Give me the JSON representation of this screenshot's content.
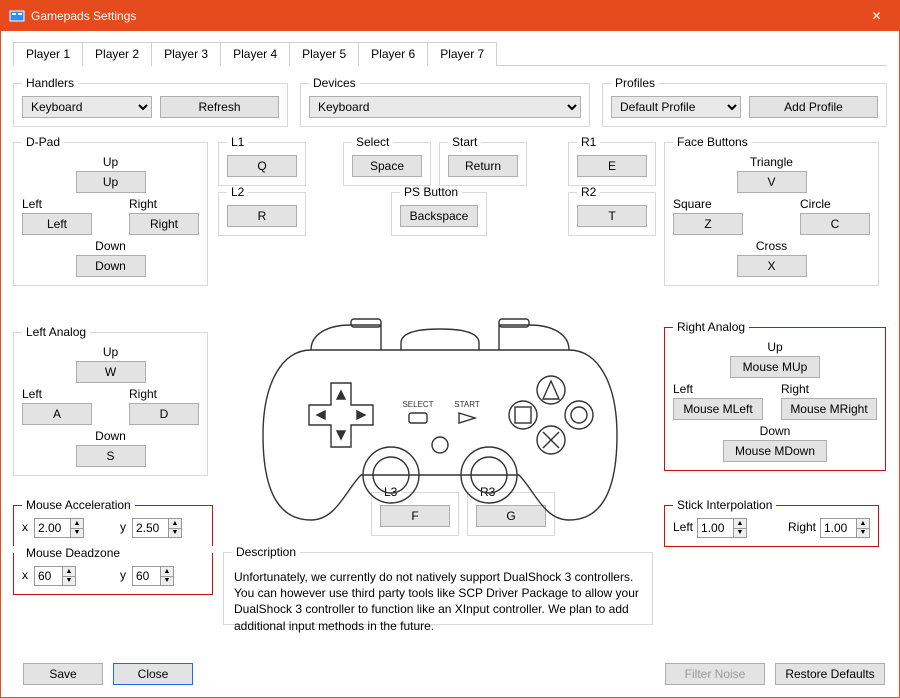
{
  "window": {
    "title": "Gamepads Settings",
    "close_glyph": "✕"
  },
  "tabs": [
    "Player 1",
    "Player 2",
    "Player 3",
    "Player 4",
    "Player 5",
    "Player 6",
    "Player 7"
  ],
  "active_tab": 0,
  "handlers": {
    "legend": "Handlers",
    "select_value": "Keyboard",
    "refresh": "Refresh"
  },
  "devices": {
    "legend": "Devices",
    "select_value": "Keyboard"
  },
  "profiles": {
    "legend": "Profiles",
    "select_value": "Default Profile",
    "add": "Add Profile"
  },
  "dpad": {
    "legend": "D-Pad",
    "up": {
      "label": "Up",
      "value": "Up"
    },
    "left": {
      "label": "Left",
      "value": "Left"
    },
    "right": {
      "label": "Right",
      "value": "Right"
    },
    "down": {
      "label": "Down",
      "value": "Down"
    }
  },
  "l1": {
    "legend": "L1",
    "value": "Q"
  },
  "l2": {
    "legend": "L2",
    "value": "R"
  },
  "select_btn": {
    "legend": "Select",
    "value": "Space"
  },
  "start_btn": {
    "legend": "Start",
    "value": "Return"
  },
  "ps": {
    "legend": "PS Button",
    "value": "Backspace"
  },
  "r1": {
    "legend": "R1",
    "value": "E"
  },
  "r2": {
    "legend": "R2",
    "value": "T"
  },
  "face": {
    "legend": "Face Buttons",
    "triangle": {
      "label": "Triangle",
      "value": "V"
    },
    "square": {
      "label": "Square",
      "value": "Z"
    },
    "circle": {
      "label": "Circle",
      "value": "C"
    },
    "cross": {
      "label": "Cross",
      "value": "X"
    }
  },
  "left_analog": {
    "legend": "Left Analog",
    "up": {
      "label": "Up",
      "value": "W"
    },
    "left": {
      "label": "Left",
      "value": "A"
    },
    "right": {
      "label": "Right",
      "value": "D"
    },
    "down": {
      "label": "Down",
      "value": "S"
    }
  },
  "right_analog": {
    "legend": "Right Analog",
    "up": {
      "label": "Up",
      "value": "Mouse MUp"
    },
    "left": {
      "label": "Left",
      "value": "Mouse MLeft"
    },
    "right": {
      "label": "Right",
      "value": "Mouse MRight"
    },
    "down": {
      "label": "Down",
      "value": "Mouse MDown"
    }
  },
  "l3": {
    "legend": "L3",
    "value": "F"
  },
  "r3": {
    "legend": "R3",
    "value": "G"
  },
  "mouse_accel": {
    "legend": "Mouse Acceleration",
    "xl": "x",
    "yl": "y",
    "x": "2.00",
    "y": "2.50"
  },
  "mouse_dead": {
    "legend": "Mouse Deadzone",
    "xl": "x",
    "yl": "y",
    "x": "60",
    "y": "60"
  },
  "stick_interp": {
    "legend": "Stick Interpolation",
    "leftl": "Left",
    "rightl": "Right",
    "left": "1.00",
    "right": "1.00"
  },
  "description": {
    "legend": "Description",
    "text": "Unfortunately, we currently do not natively support DualShock 3 controllers. You can however use third party tools like SCP Driver Package to allow your DualShock 3 controller to function like an XInput controller. We plan to add additional input methods in the future."
  },
  "buttons": {
    "save": "Save",
    "close": "Close",
    "filter_noise": "Filter Noise",
    "restore_defaults": "Restore Defaults"
  },
  "controller_labels": {
    "select": "SELECT",
    "start": "START"
  }
}
